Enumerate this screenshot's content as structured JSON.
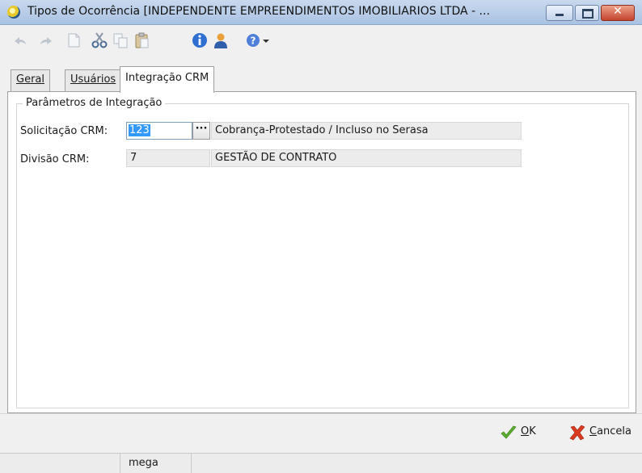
{
  "window": {
    "title": "Tipos de Ocorrência [INDEPENDENTE EMPREENDIMENTOS IMOBILIARIOS LTDA - ...",
    "icon": "app-icon",
    "controls": [
      "minimize",
      "maximize",
      "close"
    ]
  },
  "toolbar": {
    "items": [
      "undo-icon",
      "redo-icon",
      "new-document-icon",
      "cut-icon",
      "copy-icon",
      "paste-icon",
      "info-icon",
      "user-icon",
      "help-icon",
      "dropdown-arrow-icon"
    ]
  },
  "tabs": [
    {
      "label": "Geral",
      "active": false
    },
    {
      "label": "Usuários",
      "active": false
    },
    {
      "label": "Integração CRM",
      "active": true
    }
  ],
  "group": {
    "title": "Parâmetros de Integração"
  },
  "fields": {
    "solicitacao": {
      "label": "Solicitação CRM:",
      "code": "123",
      "lookup_button": "···",
      "description": "Cobrança-Protestado / Incluso no Serasa"
    },
    "divisao": {
      "label": "Divisão CRM:",
      "code": "7",
      "description": "GESTÃO DE CONTRATO"
    }
  },
  "actions": {
    "ok": "OK",
    "cancel": "Cancela"
  },
  "statusbar": {
    "cells": [
      "",
      "mega",
      ""
    ]
  },
  "colors": {
    "selection": "#3399ff",
    "ok_icon": "#5cb030",
    "cancel_icon": "#d93a20"
  }
}
